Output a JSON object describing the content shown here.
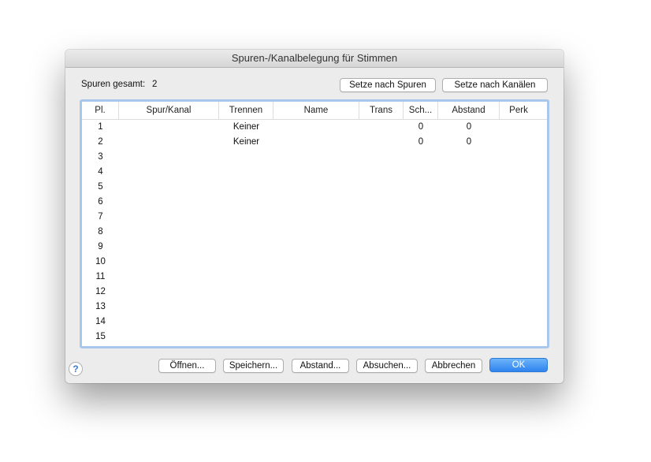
{
  "dialog": {
    "title": "Spuren-/Kanalbelegung für Stimmen"
  },
  "summary": {
    "label": "Spuren gesamt:",
    "value": "2"
  },
  "top_buttons": {
    "by_tracks": "Setze nach Spuren",
    "by_channels": "Setze nach Kanälen"
  },
  "table": {
    "columns": [
      "Pl.",
      "Spur/Kanal",
      "Trennen",
      "Name",
      "Trans",
      "Sch...",
      "Abstand",
      "Perk"
    ],
    "rows": [
      [
        "1",
        "",
        "Keiner",
        "",
        "",
        "0",
        "0",
        ""
      ],
      [
        "2",
        "",
        "Keiner",
        "",
        "",
        "0",
        "0",
        ""
      ],
      [
        "3",
        "",
        "",
        "",
        "",
        "",
        "",
        ""
      ],
      [
        "4",
        "",
        "",
        "",
        "",
        "",
        "",
        ""
      ],
      [
        "5",
        "",
        "",
        "",
        "",
        "",
        "",
        ""
      ],
      [
        "6",
        "",
        "",
        "",
        "",
        "",
        "",
        ""
      ],
      [
        "7",
        "",
        "",
        "",
        "",
        "",
        "",
        ""
      ],
      [
        "8",
        "",
        "",
        "",
        "",
        "",
        "",
        ""
      ],
      [
        "9",
        "",
        "",
        "",
        "",
        "",
        "",
        ""
      ],
      [
        "10",
        "",
        "",
        "",
        "",
        "",
        "",
        ""
      ],
      [
        "11",
        "",
        "",
        "",
        "",
        "",
        "",
        ""
      ],
      [
        "12",
        "",
        "",
        "",
        "",
        "",
        "",
        ""
      ],
      [
        "13",
        "",
        "",
        "",
        "",
        "",
        "",
        ""
      ],
      [
        "14",
        "",
        "",
        "",
        "",
        "",
        "",
        ""
      ],
      [
        "15",
        "",
        "",
        "",
        "",
        "",
        "",
        ""
      ]
    ]
  },
  "bottom_buttons": {
    "open": "Öffnen...",
    "save": "Speichern...",
    "spacing": "Abstand...",
    "search": "Absuchen...",
    "cancel": "Abbrechen",
    "ok": "OK"
  },
  "help": {
    "glyph": "?"
  },
  "colors": {
    "accent": "#2f84ef",
    "table_border": "#a9c6ec"
  }
}
